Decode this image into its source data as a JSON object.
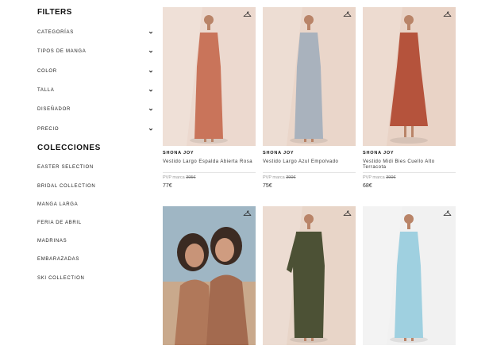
{
  "sidebar": {
    "filters_title": "FILTERS",
    "filters": [
      "CATEGORÍAS",
      "TIPOS DE MANGA",
      "COLOR",
      "TALLA",
      "DISEÑADOR",
      "PRECIO"
    ],
    "collections_title": "COLECCIONES",
    "collections": [
      "EASTER SELECTION",
      "BRIDAL COLLECTION",
      "MANGA LARGA",
      "FERIA DE ABRIL",
      "MADRINAS",
      "EMBARAZADAS",
      "SKI COLLECTION"
    ]
  },
  "products": [
    {
      "brand": "SHONA JOY",
      "name": "Vestido Largo Espalda Abierta Rosa",
      "pvp_label": "PVP marca",
      "pvp": "395€",
      "price": "77€",
      "dress_color": "#c9745a",
      "bg": "#ecd9cf"
    },
    {
      "brand": "SHONA JOY",
      "name": "Vestido Largo Azul Empolvado",
      "pvp_label": "PVP marca",
      "pvp": "390€",
      "price": "75€",
      "dress_color": "#a9b2bd",
      "bg": "#ead6ca"
    },
    {
      "brand": "SHONA JOY",
      "name": "Vestido Midi Bies Cuello Alto Terracota",
      "pvp_label": "PVP marca",
      "pvp": "390€",
      "price": "68€",
      "dress_color": "#b5533c",
      "bg": "#e9d3c6"
    },
    {
      "brand": "",
      "name": "",
      "pvp_label": "",
      "pvp": "",
      "price": "",
      "dress_color": "#b0785a",
      "bg": "#9fb6c4"
    },
    {
      "brand": "",
      "name": "",
      "pvp_label": "",
      "pvp": "",
      "price": "",
      "dress_color": "#4c5135",
      "bg": "#e8d5c8"
    },
    {
      "brand": "",
      "name": "",
      "pvp_label": "",
      "pvp": "",
      "price": "",
      "dress_color": "#9fd0e0",
      "bg": "#f1f1f1"
    }
  ]
}
